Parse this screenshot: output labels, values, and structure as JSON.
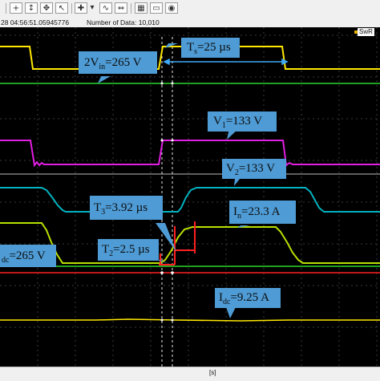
{
  "toolbar": {
    "buttons": [
      {
        "name": "zoom-in-icon",
        "glyph": "+"
      },
      {
        "name": "cursor-tool-icon",
        "glyph": "↕"
      },
      {
        "name": "move-icon",
        "glyph": "✥"
      },
      {
        "name": "pointer-icon",
        "glyph": "↖"
      },
      {
        "name": "marker-icon",
        "glyph": "✚"
      },
      {
        "name": "marker-dropdown-icon",
        "glyph": "▾"
      },
      {
        "name": "wave-small-icon",
        "glyph": "∿"
      },
      {
        "name": "scale-icon",
        "glyph": "⇔"
      },
      {
        "name": "display-icon",
        "glyph": "▦"
      },
      {
        "name": "screen-icon",
        "glyph": "▭"
      },
      {
        "name": "record-icon",
        "glyph": "◉"
      }
    ]
  },
  "info": {
    "timestamp": "28 04:56:51.05945776",
    "count": "Number of Data: 10,010"
  },
  "swr_label": "SwR",
  "x_unit": "[s]",
  "colors": {
    "background": "#000000",
    "grid": "#3a3a3a",
    "trace_yellow": "#ffe800",
    "trace_green": "#33ff33",
    "trace_magenta": "#e21ee2",
    "trace_cyan": "#00b2c0",
    "trace_lime": "#b8e000",
    "trace_red": "#ff2020",
    "annotation_fill": "#4e9bd5",
    "arrow": "#3fa9f5"
  },
  "annotations": {
    "ts": {
      "main": "T",
      "sub": "s",
      "rest": "=25 µs"
    },
    "vin": {
      "pre": "2V",
      "sub": "in",
      "rest": "=265 V"
    },
    "v1": {
      "main": "V",
      "sub": "1",
      "rest": "=133 V"
    },
    "v2": {
      "main": "V",
      "sub": "2",
      "rest": "=133 V"
    },
    "t3": {
      "main": "T",
      "sub": "3",
      "rest": "=3.92 µs"
    },
    "in": {
      "main": "I",
      "sub": "n",
      "rest": "=23.3 A"
    },
    "vdc": {
      "main": "",
      "sub": "dc",
      "rest": "=265 V"
    },
    "t2": {
      "main": "T",
      "sub": "2",
      "rest": "=2.5 µs"
    },
    "idc": {
      "main": "I",
      "sub": "dc",
      "rest": "=9.25 A"
    }
  }
}
